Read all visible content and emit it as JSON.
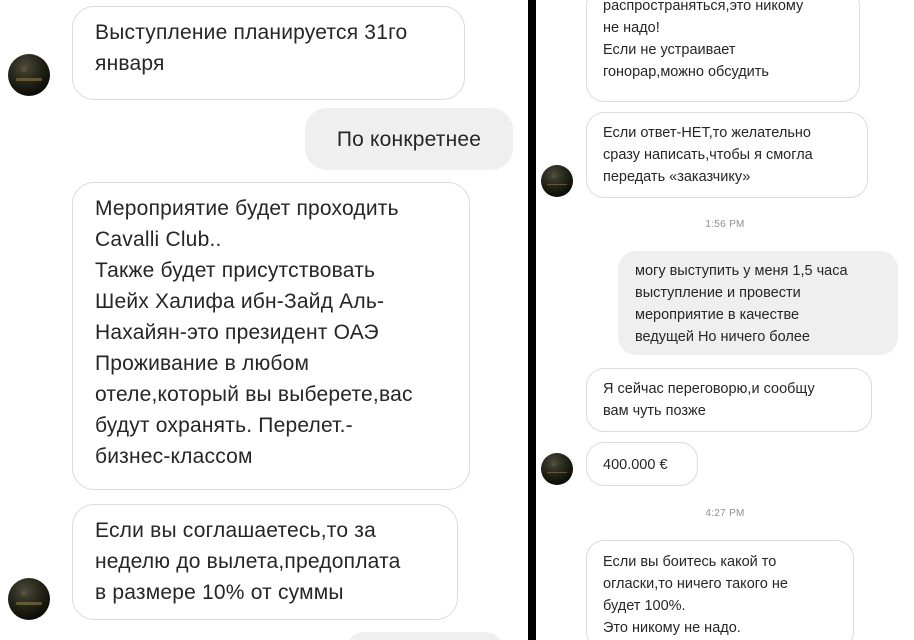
{
  "left": {
    "messages": [
      {
        "text": "Выступление планируется 31го\nянваря",
        "type": "received"
      },
      {
        "text": "По конкретнее",
        "type": "sent"
      },
      {
        "text": "Мероприятие будет проходить\nCavalli Club..\nТакже будет присутствовать\nШейх Халифа ибн-Зайд Аль-\nНахайян-это президент ОАЭ\nПроживание в любом\nотеле,который вы выберете,вас\nбудут охранять. Перелет.-\nбизнес-классом",
        "type": "received"
      },
      {
        "text": "Если вы соглашаетесь,то за\nнеделю до вылета,предоплата\nв размере 10% от суммы",
        "type": "received"
      }
    ]
  },
  "right": {
    "messages": [
      {
        "text": "распространяться,это никому\nне надо!\nЕсли не устраивает\nгонорар,можно обсудить",
        "type": "received"
      },
      {
        "text": "Если ответ-НЕТ,то желательно\nсразу написать,чтобы я смогла\nпередать «заказчику»",
        "type": "received"
      },
      {
        "text": "могу выступить у меня 1,5 часа\nвыступление и провести\nмероприятие в качестве\nведущей Но ничего более",
        "type": "sent"
      },
      {
        "text": "Я сейчас переговорю,и сообщу\nвам чуть позже",
        "type": "received"
      },
      {
        "text": "400.000 €",
        "type": "received"
      },
      {
        "text": "Если вы боитесь какой то\nогласки,то ничего такого не\nбудет 100%.\nЭто никому не надо.",
        "type": "received"
      }
    ],
    "timestamps": [
      "1:56 PM",
      "4:27 PM"
    ]
  },
  "colors": {
    "sent_bubble": "#efefef",
    "received_border": "#dbdbdb",
    "timestamp_text": "#8e8e8e",
    "divider": "#000000"
  }
}
